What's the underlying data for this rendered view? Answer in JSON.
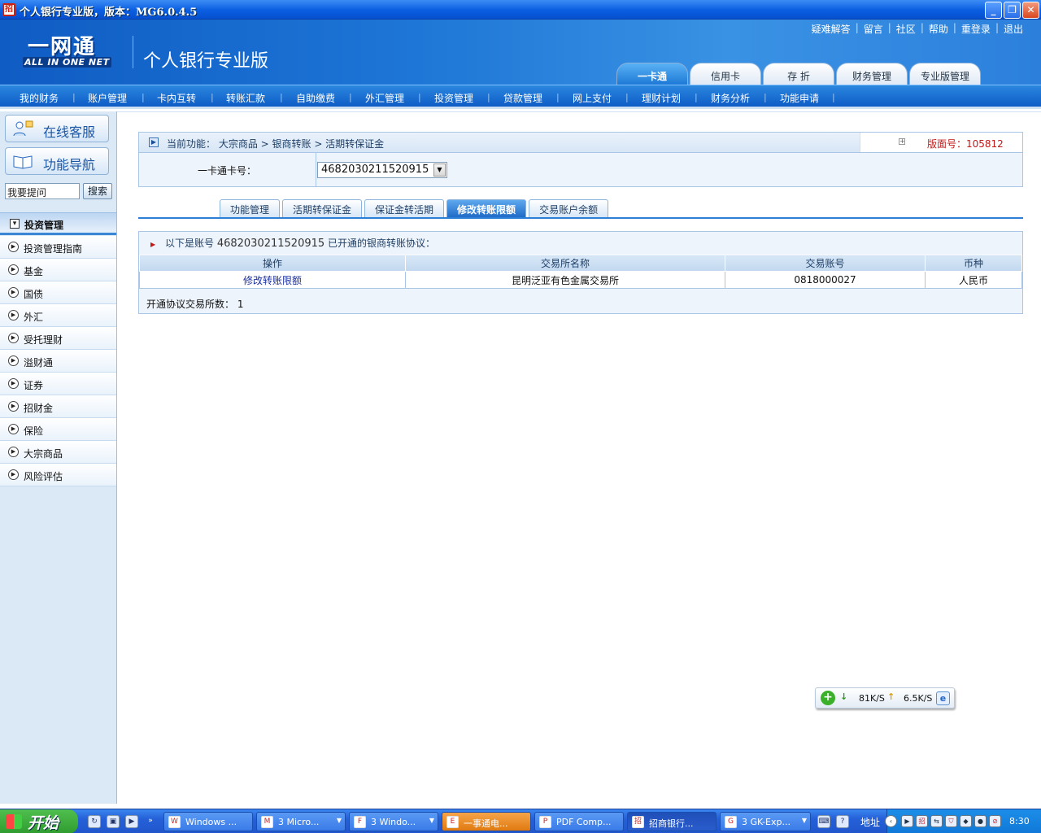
{
  "window": {
    "title": "个人银行专业版，版本：MG6.0.4.5",
    "app_icon": "招"
  },
  "header": {
    "logo_main": "一网通",
    "logo_sub": "ALL IN ONE NET",
    "product_name": "个人银行专业版",
    "top_links": [
      "疑难解答",
      "留言",
      "社区",
      "帮助",
      "重登录",
      "退出"
    ],
    "main_tabs": [
      {
        "label": "一卡通",
        "active": true
      },
      {
        "label": "信用卡",
        "active": false
      },
      {
        "label": "存  折",
        "active": false
      },
      {
        "label": "财务管理",
        "active": false
      },
      {
        "label": "专业版管理",
        "active": false
      }
    ]
  },
  "menu": {
    "items": [
      "我的财务",
      "账户管理",
      "卡内互转",
      "转账汇款",
      "自助缴费",
      "外汇管理",
      "投资管理",
      "贷款管理",
      "网上支付",
      "理财计划",
      "财务分析",
      "功能申请"
    ]
  },
  "sidebar": {
    "online_service": "在线客服",
    "nav_guide": "功能导航",
    "ask_value": "我要提问",
    "search_label": "搜索",
    "section_title": "投资管理",
    "items": [
      "投资管理指南",
      "基金",
      "国债",
      "外汇",
      "受托理财",
      "溢财通",
      "证券",
      "招财金",
      "保险",
      "大宗商品",
      "风险评估"
    ]
  },
  "content": {
    "breadcrumb": "当前功能：  大宗商品  > 银商转账  > 活期转保证金",
    "version_label": "版面号：105812",
    "card_label": "一卡通卡号：",
    "card_number": "4682030211520915",
    "sub_tabs": [
      {
        "label": "功能管理",
        "active": false
      },
      {
        "label": "活期转保证金",
        "active": false
      },
      {
        "label": "保证金转活期",
        "active": false
      },
      {
        "label": "修改转账限额",
        "active": true
      },
      {
        "label": "交易账户余额",
        "active": false
      }
    ],
    "list_head_prefix": "以下是账号",
    "list_head_account": "4682030211520915",
    "list_head_suffix": "已开通的银商转账协议：",
    "table": {
      "headers": [
        "操作",
        "交易所名称",
        "交易账号",
        "币种"
      ],
      "rows": [
        [
          "修改转账限额",
          "昆明泛亚有色金属交易所",
          "0818000027",
          "人民币"
        ]
      ]
    },
    "count_label": "开通协议交易所数：",
    "count_value": "1"
  },
  "speed_widget": {
    "down": "81K/S",
    "up": "6.5K/S"
  },
  "taskbar": {
    "start_label": "开始",
    "tasks": [
      {
        "label": "Windows ...",
        "icon": "W"
      },
      {
        "label": "3 Micro...",
        "icon": "M"
      },
      {
        "label": "3 Windo...",
        "icon": "F"
      },
      {
        "label": "一事通电...",
        "icon": "E"
      },
      {
        "label": "PDF Comp...",
        "icon": "P"
      },
      {
        "label": "招商银行...",
        "icon": "招"
      },
      {
        "label": "3 GK-Exp...",
        "icon": "G"
      }
    ],
    "address_label": "地址",
    "clock": "8:30"
  }
}
